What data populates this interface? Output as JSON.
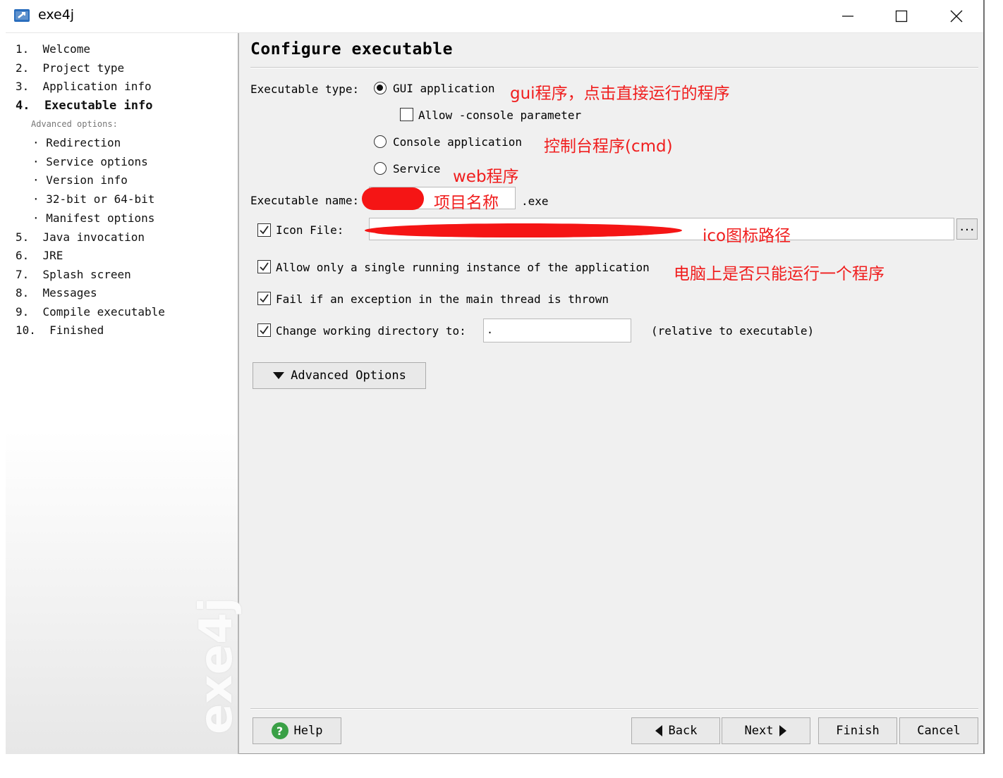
{
  "window": {
    "title": "exe4j"
  },
  "sidebar": {
    "steps": [
      {
        "label": "1.  Welcome"
      },
      {
        "label": "2.  Project type"
      },
      {
        "label": "3.  Application info"
      },
      {
        "label": "4.  Executable info",
        "active": true
      },
      {
        "label": "5.  Java invocation"
      },
      {
        "label": "6.  JRE"
      },
      {
        "label": "7.  Splash screen"
      },
      {
        "label": "8.  Messages"
      },
      {
        "label": "9.  Compile executable"
      },
      {
        "label": "10.  Finished"
      }
    ],
    "advanced_label": "Advanced options:",
    "sub_items": [
      {
        "label": "· Redirection"
      },
      {
        "label": "· Service options"
      },
      {
        "label": "· Version info"
      },
      {
        "label": "· 32-bit or 64-bit"
      },
      {
        "label": "· Manifest options"
      }
    ],
    "watermark": "exe4j"
  },
  "main": {
    "title": "Configure executable",
    "executable_type": {
      "label": "Executable type:",
      "options": [
        {
          "label": "GUI application",
          "selected": true,
          "annotation": "gui程序，点击直接运行的程序"
        },
        {
          "label": "Console application",
          "selected": false,
          "annotation": "控制台程序(cmd)"
        },
        {
          "label": "Service",
          "selected": false,
          "annotation": "web程序"
        }
      ],
      "allow_console": {
        "label": "Allow -console parameter",
        "checked": false
      }
    },
    "executable_name": {
      "label": "Executable name:",
      "annotation": "项目名称",
      "suffix": ".exe"
    },
    "icon_file": {
      "label": "Icon File:",
      "checked": true,
      "annotation": "ico图标路径",
      "browse_label": "..."
    },
    "single_instance": {
      "label": "Allow only a single running instance of the application",
      "checked": true,
      "annotation": "电脑上是否只能运行一个程序"
    },
    "fail_exception": {
      "label": "Fail if an exception in the main thread is thrown",
      "checked": true
    },
    "change_dir": {
      "label": "Change working directory to:",
      "checked": true,
      "value": ".",
      "note": "(relative to executable)"
    },
    "advanced_button": "Advanced Options"
  },
  "footer": {
    "help": "Help",
    "back": "Back",
    "next": "Next",
    "finish": "Finish",
    "cancel": "Cancel"
  },
  "colors": {
    "annotation": "#f01e1e",
    "redaction": "#f51515",
    "help_icon": "#3aa046"
  }
}
